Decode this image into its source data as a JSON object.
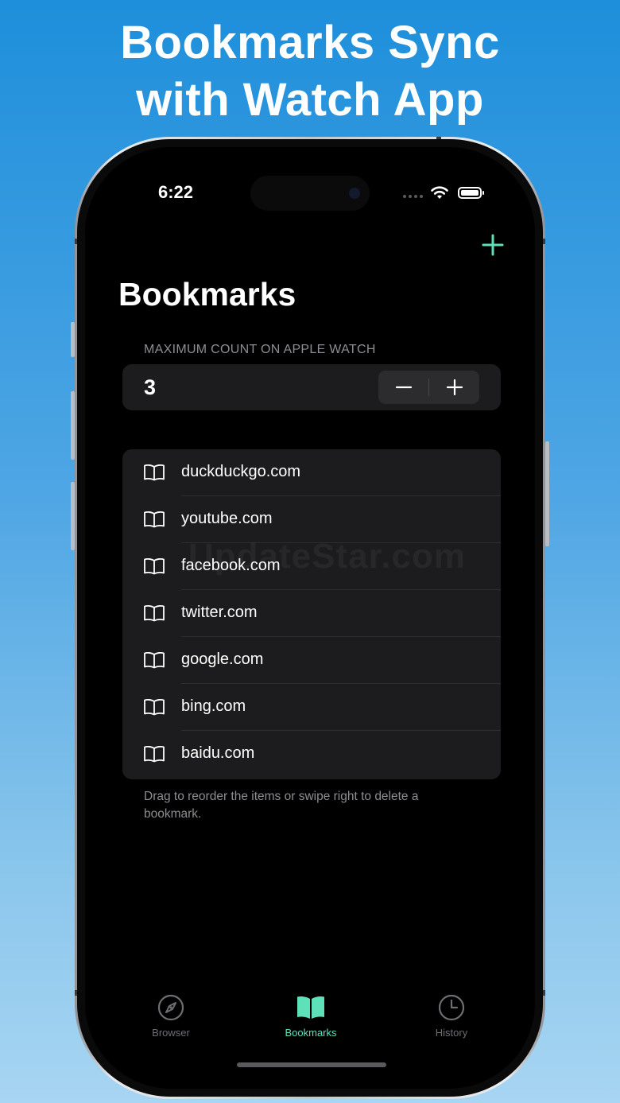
{
  "promo": {
    "headline_line1": "Bookmarks Sync",
    "headline_line2": "with Watch App"
  },
  "status_bar": {
    "time": "6:22",
    "icons": [
      "cellular-signal-icon",
      "wifi-icon",
      "battery-icon"
    ]
  },
  "nav": {
    "title": "Bookmarks",
    "add_icon": "plus-icon"
  },
  "watch_limit": {
    "header": "MAXIMUM COUNT ON APPLE WATCH",
    "value": "3",
    "decrement_icon": "minus-icon",
    "increment_icon": "plus-icon"
  },
  "bookmarks": {
    "items": [
      {
        "label": "duckduckgo.com",
        "icon": "book-icon"
      },
      {
        "label": "youtube.com",
        "icon": "book-icon"
      },
      {
        "label": "facebook.com",
        "icon": "book-icon"
      },
      {
        "label": "twitter.com",
        "icon": "book-icon"
      },
      {
        "label": "google.com",
        "icon": "book-icon"
      },
      {
        "label": "bing.com",
        "icon": "book-icon"
      },
      {
        "label": "baidu.com",
        "icon": "book-icon"
      }
    ],
    "footer": "Drag to reorder the items or swipe right to delete a bookmark."
  },
  "watermark": "UpdateStar.com",
  "tab_bar": {
    "tabs": [
      {
        "label": "Browser",
        "icon": "compass-icon",
        "selected": false
      },
      {
        "label": "Bookmarks",
        "icon": "open-book-icon",
        "selected": true
      },
      {
        "label": "History",
        "icon": "clock-icon",
        "selected": false
      }
    ]
  },
  "colors": {
    "accent": "#5ee0b8",
    "background": "#000000",
    "card": "#1c1c1e",
    "secondary_text": "#8d8d93",
    "inactive_tab": "#6e6e73"
  }
}
